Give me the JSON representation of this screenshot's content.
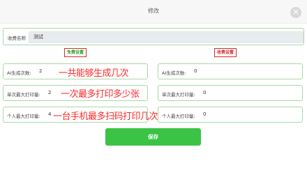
{
  "dialog": {
    "title": "修改"
  },
  "charge_name": {
    "label": "收费名称",
    "value": "测试"
  },
  "free_settings": {
    "title": "免费设置",
    "fields": [
      {
        "label": "AI生成次数:",
        "value": "2"
      },
      {
        "label": "单次最大打印量:",
        "value": "2"
      },
      {
        "label": "个人最大打印量:",
        "value": "4"
      }
    ]
  },
  "paid_settings": {
    "title": "收费设置",
    "fields": [
      {
        "label": "AI生成次数:",
        "value": "0"
      },
      {
        "label": "单次最大打印量:",
        "value": "0"
      },
      {
        "label": "个人最大打印量:",
        "value": "0"
      }
    ]
  },
  "annotations": [
    "一共能够生成几次",
    "一次最多打印多少张",
    "一台手机最多扫码打印几次"
  ],
  "save_label": "保存",
  "colors": {
    "accent_green": "#3cc346",
    "border_green": "#a9d8a9",
    "annotation_red": "#ff2a2a"
  }
}
